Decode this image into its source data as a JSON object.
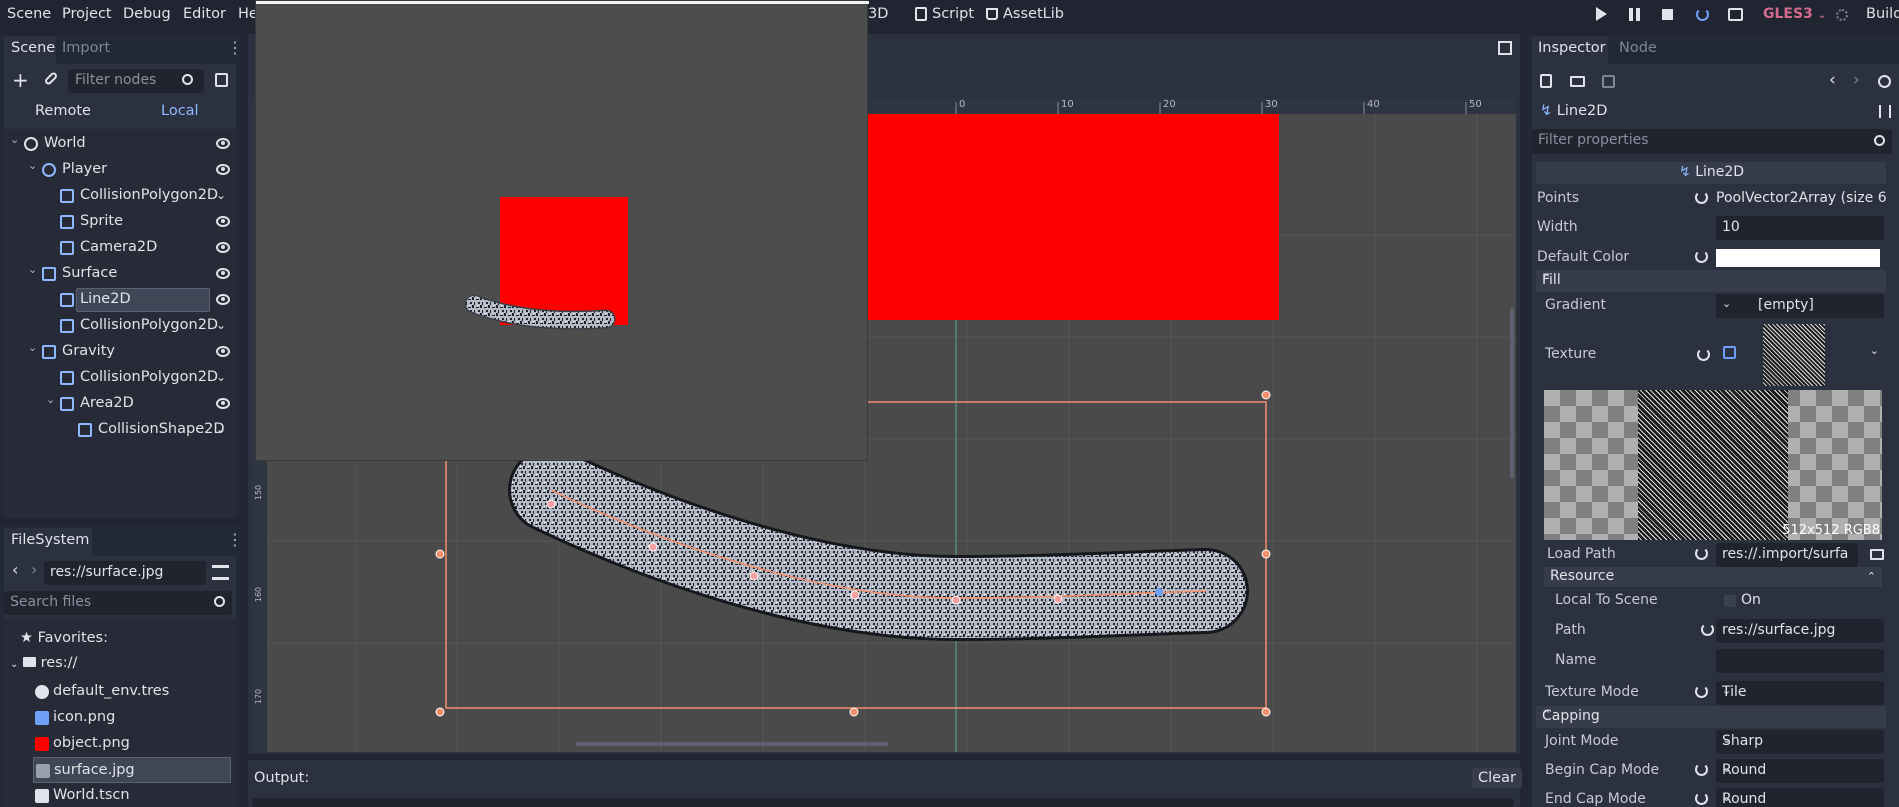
{
  "menubar": {
    "menus": [
      "Scene",
      "Project",
      "Debug",
      "Editor",
      "He"
    ],
    "workspaces": [
      "3D",
      "Script",
      "AssetLib"
    ],
    "renderer": "GLES3",
    "build": "Build"
  },
  "scene_dock": {
    "tabs": [
      "Scene",
      "Import"
    ],
    "filter_placeholder": "Filter nodes",
    "remote": "Remote",
    "local": "Local",
    "tree": [
      {
        "label": "World",
        "icon": "node-icon",
        "vis": "eye"
      },
      {
        "label": "Player",
        "icon": "kinematic-body-icon",
        "vis": "eye"
      },
      {
        "label": "CollisionPolygon2D",
        "icon": "collision-polygon-icon",
        "vis": "chevron"
      },
      {
        "label": "Sprite",
        "icon": "sprite-icon",
        "vis": "eye"
      },
      {
        "label": "Camera2D",
        "icon": "camera-icon",
        "vis": "eye"
      },
      {
        "label": "Surface",
        "icon": "static-body-icon",
        "vis": "eye"
      },
      {
        "label": "Line2D",
        "icon": "line2d-icon",
        "vis": "eye"
      },
      {
        "label": "CollisionPolygon2D",
        "icon": "collision-polygon-icon",
        "vis": "chevron"
      },
      {
        "label": "Gravity",
        "icon": "static-body-icon",
        "vis": "eye"
      },
      {
        "label": "CollisionPolygon2D",
        "icon": "collision-polygon-icon",
        "vis": "chevron"
      },
      {
        "label": "Area2D",
        "icon": "area2d-icon",
        "vis": "eye"
      },
      {
        "label": "CollisionShape2D",
        "icon": "collision-shape-icon",
        "vis": "chevron"
      }
    ]
  },
  "filesystem": {
    "title": "FileSystem",
    "path": "res://surface.jpg",
    "search_placeholder": "Search files",
    "favorites": "Favorites:",
    "root": "res://",
    "files": [
      "default_env.tres",
      "icon.png",
      "object.png",
      "surface.jpg",
      "World.tscn"
    ]
  },
  "viewport": {
    "ruler_labels": [
      "0",
      "10",
      "20",
      "30",
      "40",
      "50"
    ],
    "left_ruler_labels": [
      "150",
      "160",
      "170"
    ]
  },
  "output": {
    "label": "Output:",
    "clear": "Clear"
  },
  "inspector": {
    "tabs": [
      "Inspector",
      "Node"
    ],
    "node_name": "Line2D",
    "filter_placeholder": "Filter properties",
    "class_header": "Line2D",
    "points_label": "Points",
    "points_value": "PoolVector2Array (size 6",
    "width_label": "Width",
    "width_value": "10",
    "default_color_label": "Default Color",
    "default_color": "#ffffff",
    "fill_section": "Fill",
    "gradient_label": "Gradient",
    "gradient_value": "[empty]",
    "texture_label": "Texture",
    "texture_info": "512x512 RGB8",
    "load_path_label": "Load Path",
    "load_path_value": "res://.import/surfa",
    "resource_section": "Resource",
    "local_to_scene_label": "Local To Scene",
    "local_to_scene_value": "On",
    "path_label": "Path",
    "path_value": "res://surface.jpg",
    "name_label": "Name",
    "texture_mode_label": "Texture Mode",
    "texture_mode_value": "Tile",
    "capping_section": "Capping",
    "joint_mode_label": "Joint Mode",
    "joint_mode_value": "Sharp",
    "begin_cap_label": "Begin Cap Mode",
    "begin_cap_value": "Round",
    "end_cap_label": "End Cap Mode",
    "end_cap_value": "Round"
  },
  "colors": {
    "accent": "#6f9ff7",
    "red": "#ff0000",
    "selection_orange": "#f28e6a",
    "renderer": "#d46a8c"
  }
}
